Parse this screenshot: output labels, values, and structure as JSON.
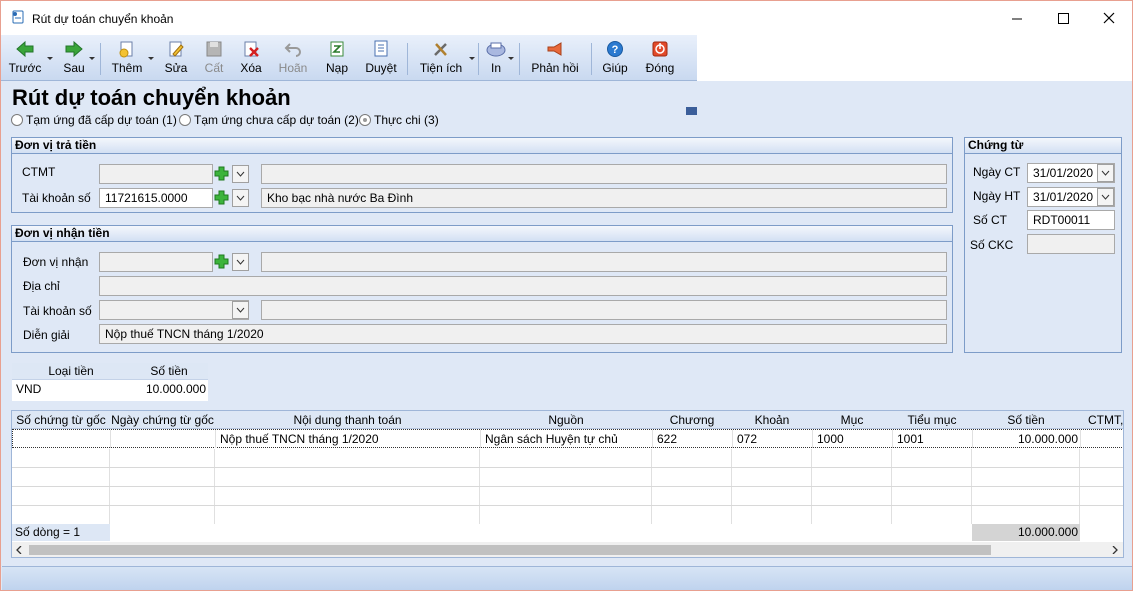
{
  "window": {
    "title": "Rút dự toán chuyển khoản"
  },
  "toolbar": {
    "prev": "Trước",
    "next": "Sau",
    "add": "Thêm",
    "edit": "Sửa",
    "save": "Cất",
    "delete": "Xóa",
    "undo": "Hoãn",
    "load": "Nạp",
    "approve": "Duyệt",
    "utilities": "Tiện ích",
    "print": "In",
    "feedback": "Phản hồi",
    "help": "Giúp",
    "close": "Đóng"
  },
  "page": {
    "title": "Rút dự toán chuyển khoản",
    "radios": [
      {
        "label": "Tạm ứng đã cấp dự toán (1)",
        "checked": false
      },
      {
        "label": "Tạm ứng chưa cấp dự toán (2)",
        "checked": false
      },
      {
        "label": "Thực chi (3)",
        "checked": true
      }
    ]
  },
  "payer": {
    "header": "Đơn vị trả tiền",
    "ctmt_label": "CTMT",
    "ctmt_value": "",
    "ctmt_name": "",
    "account_label": "Tài khoản số",
    "account_value": "11721615.0000",
    "account_bank": "Kho bạc nhà nước Ba Đình"
  },
  "receiver": {
    "header": "Đơn vị nhận tiền",
    "unit_label": "Đơn vị nhận",
    "unit_value": "",
    "unit_name": "",
    "address_label": "Địa chỉ",
    "address_value": "",
    "account_label": "Tài khoản số",
    "account_value": "",
    "account_bank": "",
    "desc_label": "Diễn giải",
    "desc_value": "Nộp thuế TNCN tháng 1/2020"
  },
  "voucher": {
    "header": "Chứng từ",
    "date_ct_label": "Ngày CT",
    "date_ct_value": "31/01/2020",
    "date_ht_label": "Ngày HT",
    "date_ht_value": "31/01/2020",
    "no_ct_label": "Số CT",
    "no_ct_value": "RDT00011",
    "no_ckc_label": "Số CKC",
    "no_ckc_value": ""
  },
  "currency": {
    "headers": [
      "Loại tiền",
      "Số tiền"
    ],
    "row": [
      "VND",
      "10.000.000"
    ]
  },
  "grid": {
    "headers": [
      "Số chứng từ gốc",
      "Ngày chứng từ gốc",
      "Nội dung thanh toán",
      "Nguồn",
      "Chương",
      "Khoản",
      "Mục",
      "Tiểu mục",
      "Số tiền",
      "CTMT,"
    ],
    "row": [
      "",
      "",
      "Nộp thuế TNCN tháng 1/2020",
      "Ngân sách Huyện tự chủ",
      "622",
      "072",
      "1000",
      "1001",
      "10.000.000",
      ""
    ],
    "footer_count": "Số dòng = 1",
    "footer_total": "10.000.000"
  }
}
